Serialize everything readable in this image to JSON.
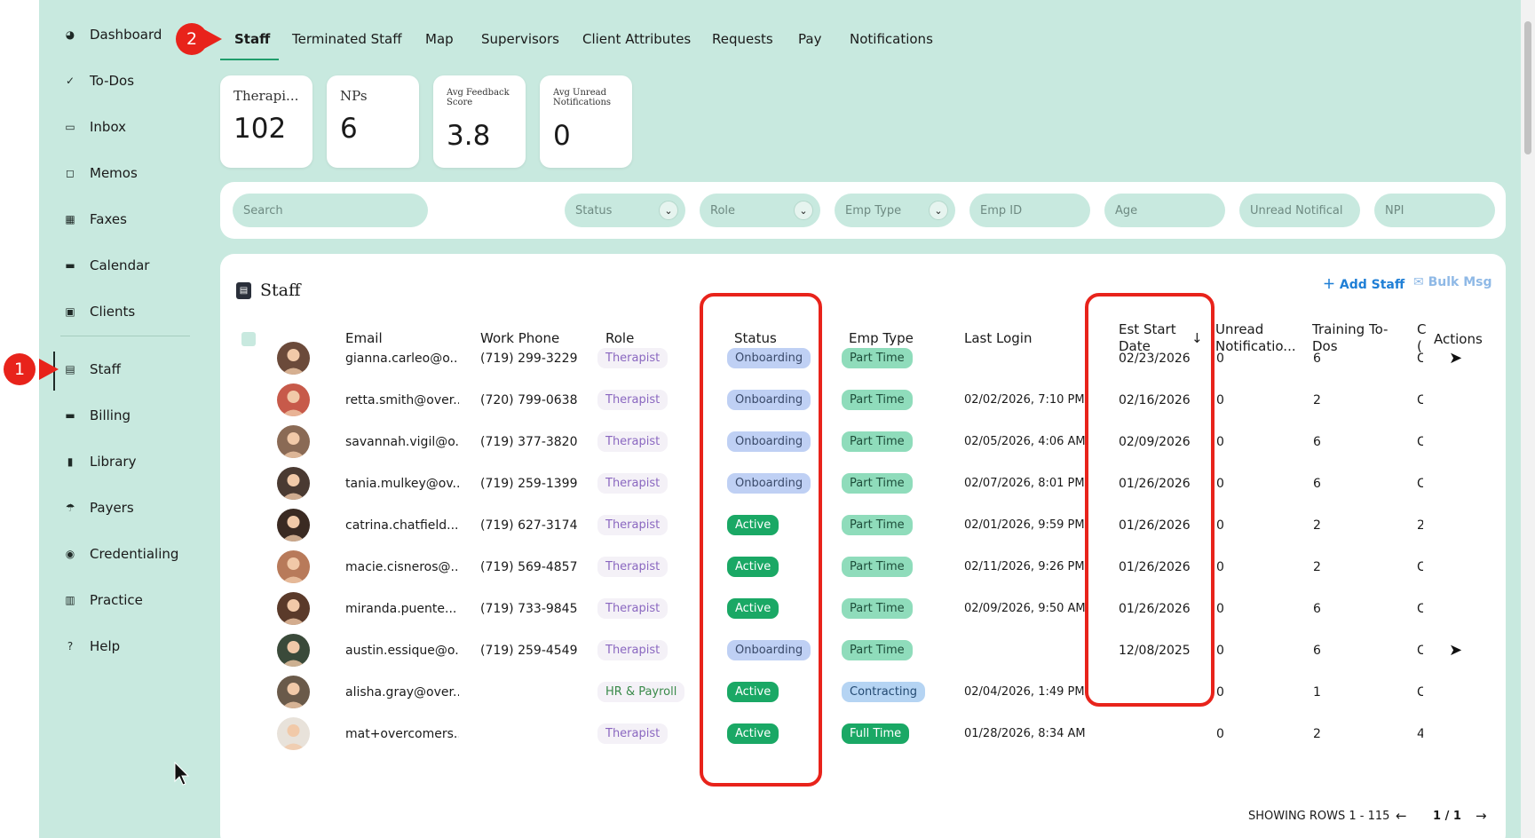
{
  "sidebar": {
    "items": [
      {
        "label": "Dashboard",
        "icon": "dashboard-icon",
        "glyph": "◕"
      },
      {
        "label": "To-Dos",
        "icon": "todos-icon",
        "glyph": "✓"
      },
      {
        "label": "Inbox",
        "icon": "inbox-icon",
        "glyph": "▭"
      },
      {
        "label": "Memos",
        "icon": "memo-icon",
        "glyph": "◻"
      },
      {
        "label": "Faxes",
        "icon": "fax-icon",
        "glyph": "▦"
      },
      {
        "label": "Calendar",
        "icon": "calendar-icon",
        "glyph": "▬"
      },
      {
        "label": "Clients",
        "icon": "clients-icon",
        "glyph": "▣"
      },
      {
        "label": "Staff",
        "icon": "staff-icon",
        "glyph": "▤"
      },
      {
        "label": "Billing",
        "icon": "billing-icon",
        "glyph": "▬"
      },
      {
        "label": "Library",
        "icon": "library-icon",
        "glyph": "▮"
      },
      {
        "label": "Payers",
        "icon": "payers-icon",
        "glyph": "☂"
      },
      {
        "label": "Credentialing",
        "icon": "credentialing-icon",
        "glyph": "◉"
      },
      {
        "label": "Practice",
        "icon": "practice-icon",
        "glyph": "▥"
      },
      {
        "label": "Help",
        "icon": "help-icon",
        "glyph": "?"
      }
    ]
  },
  "markers": {
    "one": "1",
    "two": "2"
  },
  "tabs": [
    "Staff",
    "Terminated Staff",
    "Map",
    "Supervisors",
    "Client Attributes",
    "Requests",
    "Pay",
    "Notifications"
  ],
  "stats": [
    {
      "label": "Therapi...",
      "value": "102"
    },
    {
      "label": "NPs",
      "value": "6"
    },
    {
      "label": "Avg Feedback Score",
      "value": "3.8"
    },
    {
      "label": "Avg Unread Notifications",
      "value": "0"
    }
  ],
  "filters": {
    "search": "Search",
    "status": "Status",
    "role": "Role",
    "emp_type": "Emp Type",
    "emp_id": "Emp ID",
    "age": "Age",
    "unread": "Unread Notifical",
    "npi": "NPI"
  },
  "panel": {
    "title": "Staff",
    "add_staff": "Add Staff",
    "bulk_msg": "Bulk Msg"
  },
  "columns": {
    "email": "Email",
    "work_phone": "Work Phone",
    "role": "Role",
    "status": "Status",
    "emp_type": "Emp Type",
    "last_login": "Last Login",
    "est_start": "Est Start Date",
    "unread": "Unread Notificatio...",
    "training": "Training To-Dos",
    "cut": "C (",
    "actions": "Actions"
  },
  "rows": [
    {
      "email": "gianna.carleo@o...",
      "phone": "(719) 299-3229",
      "role": "Therapist",
      "status": "Onboarding",
      "emp": "Part Time",
      "login": "",
      "start": "02/23/2026",
      "unread": "0",
      "training": "6",
      "c": "C",
      "action": true,
      "av": "#6b4a3a"
    },
    {
      "email": "retta.smith@over...",
      "phone": "(720) 799-0638",
      "role": "Therapist",
      "status": "Onboarding",
      "emp": "Part Time",
      "login": "02/02/2026, 7:10 PM",
      "start": "02/16/2026",
      "unread": "0",
      "training": "2",
      "c": "C",
      "action": false,
      "av": "#c75a4a"
    },
    {
      "email": "savannah.vigil@o...",
      "phone": "(719) 377-3820",
      "role": "Therapist",
      "status": "Onboarding",
      "emp": "Part Time",
      "login": "02/05/2026, 4:06 AM",
      "start": "02/09/2026",
      "unread": "0",
      "training": "6",
      "c": "C",
      "action": false,
      "av": "#8a6a55"
    },
    {
      "email": "tania.mulkey@ov...",
      "phone": "(719) 259-1399",
      "role": "Therapist",
      "status": "Onboarding",
      "emp": "Part Time",
      "login": "02/07/2026, 8:01 PM",
      "start": "01/26/2026",
      "unread": "0",
      "training": "6",
      "c": "C",
      "action": false,
      "av": "#4a3a32"
    },
    {
      "email": "catrina.chatfield...",
      "phone": "(719) 627-3174",
      "role": "Therapist",
      "status": "Active",
      "emp": "Part Time",
      "login": "02/01/2026, 9:59 PM",
      "start": "01/26/2026",
      "unread": "0",
      "training": "2",
      "c": "2",
      "action": false,
      "av": "#3a2a22"
    },
    {
      "email": "macie.cisneros@...",
      "phone": "(719) 569-4857",
      "role": "Therapist",
      "status": "Active",
      "emp": "Part Time",
      "login": "02/11/2026, 9:26 PM",
      "start": "01/26/2026",
      "unread": "0",
      "training": "2",
      "c": "C",
      "action": false,
      "av": "#b87a5a"
    },
    {
      "email": "miranda.puente...",
      "phone": "(719) 733-9845",
      "role": "Therapist",
      "status": "Active",
      "emp": "Part Time",
      "login": "02/09/2026, 9:50 AM",
      "start": "01/26/2026",
      "unread": "0",
      "training": "6",
      "c": "C",
      "action": false,
      "av": "#5a3a2a"
    },
    {
      "email": "austin.essique@o...",
      "phone": "(719) 259-4549",
      "role": "Therapist",
      "status": "Onboarding",
      "emp": "Part Time",
      "login": "",
      "start": "12/08/2025",
      "unread": "0",
      "training": "6",
      "c": "C",
      "action": true,
      "av": "#3a4a3a"
    },
    {
      "email": "alisha.gray@over...",
      "phone": "",
      "role": "HR & Payroll",
      "status": "Active",
      "emp": "Contracting",
      "login": "02/04/2026, 1:49 PM",
      "start": "",
      "unread": "0",
      "training": "1",
      "c": "C",
      "action": false,
      "av": "#6a5a4a"
    },
    {
      "email": "mat+overcomers...",
      "phone": "",
      "role": "Therapist",
      "status": "Active",
      "emp": "Full Time",
      "login": "01/28/2026, 8:34 AM",
      "start": "",
      "unread": "0",
      "training": "2",
      "c": "4",
      "action": false,
      "av": "#e8e2da"
    }
  ],
  "footer": {
    "showing": "SHOWING ROWS 1 - 115",
    "page": "1 / 1",
    "prev": "←",
    "next": "→"
  }
}
